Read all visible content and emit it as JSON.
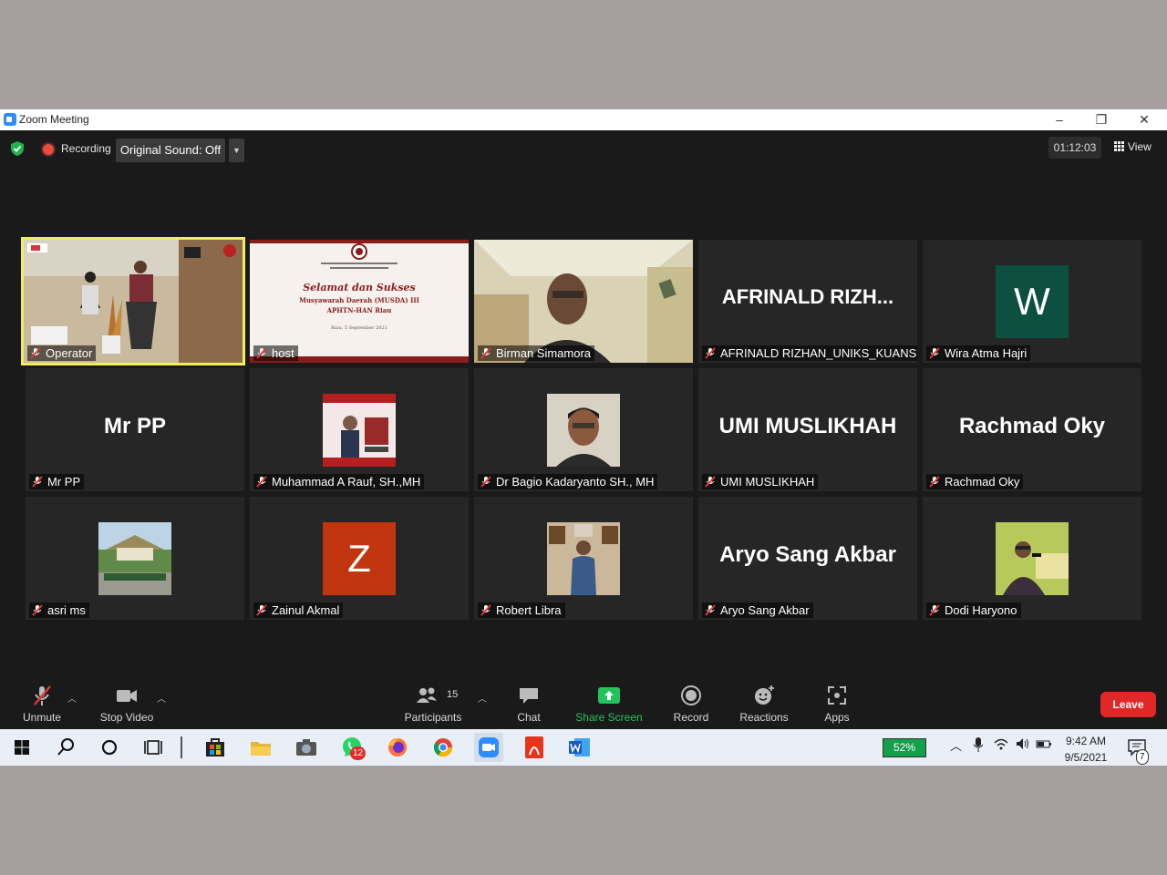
{
  "window": {
    "title": "Zoom Meeting",
    "minimize": "–",
    "restore": "❐",
    "close": "✕"
  },
  "topbar": {
    "recording": "Recording",
    "original_sound": "Original Sound: Off",
    "timer": "01:12:03",
    "view": "View"
  },
  "tiles": [
    {
      "name": "Operator",
      "kind": "video",
      "active": true
    },
    {
      "name": "host",
      "kind": "slide",
      "slide_title": "Selamat dan Sukses",
      "slide_line1": "Musyawarah Daerah (MUSDA) III",
      "slide_line2": "APHTN-HAN Riau",
      "slide_line3": "Riau, 5 September 2021"
    },
    {
      "name": "Birman Simamora",
      "kind": "video"
    },
    {
      "name": "AFRINALD RIZHAN_UNIKS_KUANSING",
      "kind": "text",
      "big": "AFRINALD  RIZH..."
    },
    {
      "name": "Wira Atma Hajri",
      "kind": "letter",
      "letter": "W",
      "color": "#0d4f40"
    },
    {
      "name": "Mr PP",
      "kind": "text",
      "big": "Mr PP"
    },
    {
      "name": "Muhammad A Rauf, SH.,MH",
      "kind": "photo"
    },
    {
      "name": "Dr Bagio Kadaryanto SH., MH",
      "kind": "photo"
    },
    {
      "name": "UMI MUSLIKHAH",
      "kind": "text",
      "big": "UMI MUSLIKHAH"
    },
    {
      "name": "Rachmad Oky",
      "kind": "text",
      "big": "Rachmad Oky"
    },
    {
      "name": "asri ms",
      "kind": "photo"
    },
    {
      "name": "Zainul Akmal",
      "kind": "letter",
      "letter": "Z",
      "color": "#c2360f"
    },
    {
      "name": "Robert Libra",
      "kind": "photo"
    },
    {
      "name": "Aryo Sang Akbar",
      "kind": "text",
      "big": "Aryo Sang Akbar"
    },
    {
      "name": "Dodi Haryono",
      "kind": "photo"
    }
  ],
  "toolbar": {
    "unmute": "Unmute",
    "stop_video": "Stop Video",
    "participants": "Participants",
    "participants_count": "15",
    "chat": "Chat",
    "share_screen": "Share Screen",
    "record": "Record",
    "reactions": "Reactions",
    "apps": "Apps",
    "leave": "Leave"
  },
  "taskbar": {
    "battery": "52%",
    "time": "9:42 AM",
    "date": "9/5/2021",
    "whatsapp_badge": "12",
    "notification_count": "7"
  },
  "colors": {
    "accent_green": "#22c35a",
    "leave_red": "#e02828",
    "active_speaker": "#f1ed5d",
    "zoom_blue": "#2d8cff"
  }
}
